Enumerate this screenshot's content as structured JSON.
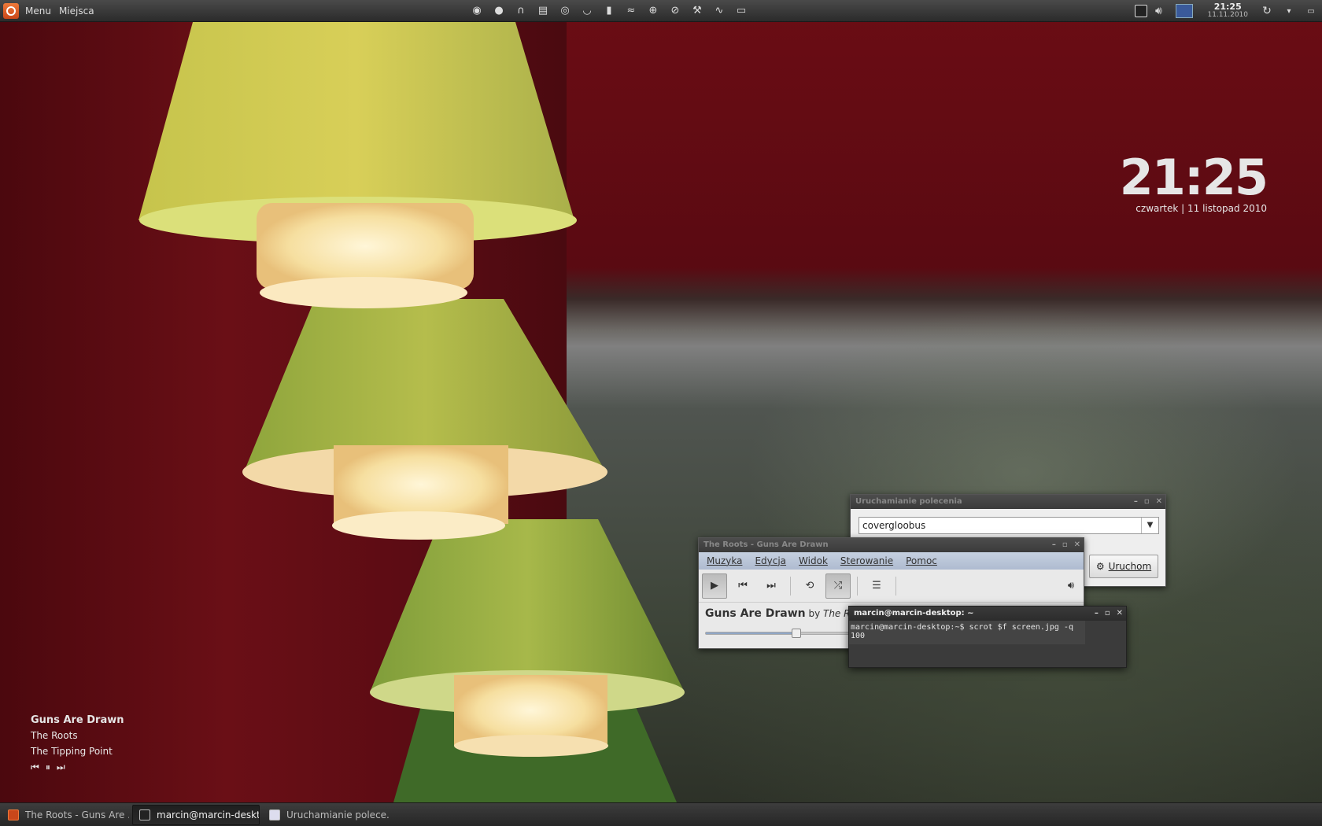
{
  "top_panel": {
    "menu_label": "Menu",
    "places_label": "Miejsca",
    "launchers": [
      "firefox-icon",
      "chat-icon",
      "headphones-icon",
      "video-icon",
      "disc-icon",
      "tea-icon",
      "notes-icon",
      "weather-icon",
      "globe-icon",
      "cd-icon",
      "wrench-icon",
      "monitor-icon",
      "window-icon"
    ],
    "clock_time": "21:25",
    "clock_date": "11.11.2010"
  },
  "desktop_clock": {
    "time": "21:25",
    "date": "czwartek | 11 listopad 2010"
  },
  "now_playing": {
    "title": "Guns Are Drawn",
    "artist": "The Roots",
    "album": "The Tipping Point"
  },
  "run_dialog": {
    "title": "Uruchamianie polecenia",
    "command": "covergloobus",
    "run_button": "Uruchom"
  },
  "player": {
    "title": "The Roots - Guns Are Drawn",
    "menu": [
      "Muzyka",
      "Edycja",
      "Widok",
      "Sterowanie",
      "Pomoc"
    ],
    "song_title": "Guns Are Drawn",
    "by": "by",
    "artist": "The Roots",
    "progress": 0.58
  },
  "terminal": {
    "title": "marcin@marcin-desktop: ~",
    "line": "marcin@marcin-desktop:~$ scrot $f screen.jpg -q 100"
  },
  "taskbar": [
    {
      "label": "The Roots - Guns Are ..."
    },
    {
      "label": "marcin@marcin-deskt..."
    },
    {
      "label": "Uruchamianie polece..."
    }
  ]
}
